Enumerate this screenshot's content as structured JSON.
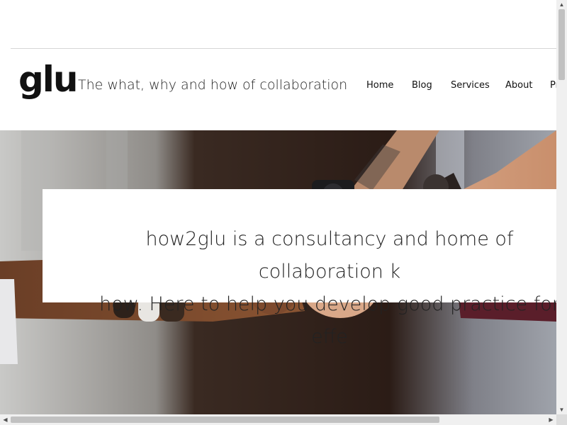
{
  "header": {
    "logo": "glu",
    "tagline": "The what, why and how of collaboration"
  },
  "nav": {
    "items": [
      {
        "label": "Home"
      },
      {
        "label": "Blog"
      },
      {
        "label": "Services"
      },
      {
        "label": "About"
      },
      {
        "label": "Pr"
      }
    ]
  },
  "hero": {
    "image_description_icon": "team-fist-bump-photo"
  },
  "intro": {
    "text": "how2glu is a consultancy and home of collaboration k\nhow. Here to help you develop good practice for effe"
  },
  "scrollbars": {
    "up_icon": "▲",
    "down_icon": "▼",
    "left_icon": "◀",
    "right_icon": "▶"
  }
}
